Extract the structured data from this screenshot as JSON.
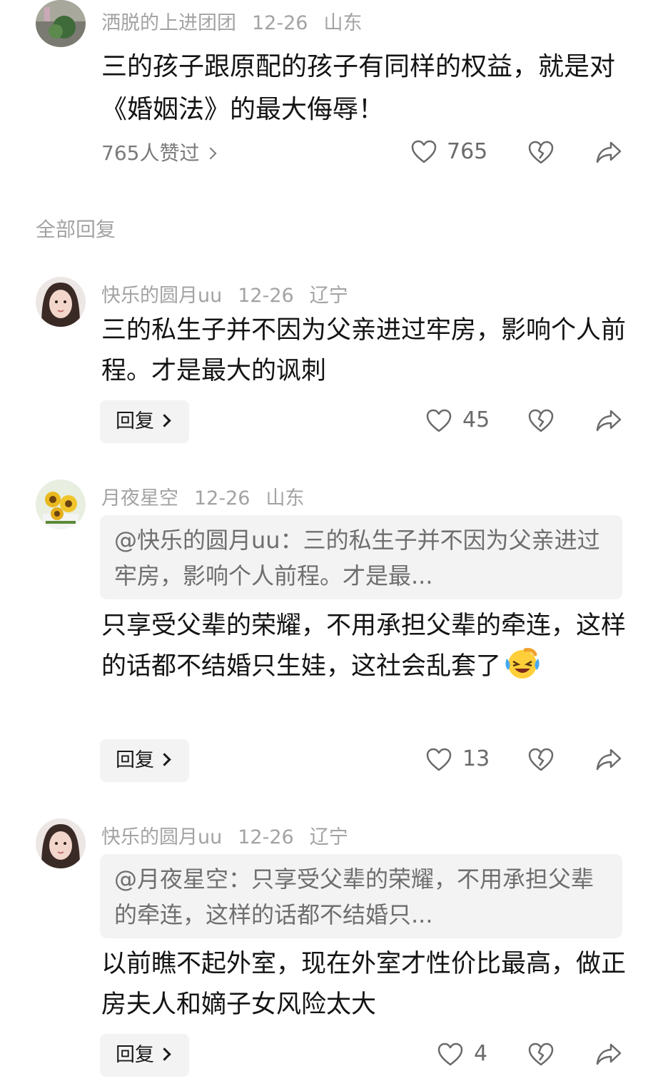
{
  "main_comment": {
    "username": "洒脱的上进团团",
    "date": "12-26",
    "location": "山东",
    "text": "三的孩子跟原配的孩子有同样的权益，就是对《婚姻法》的最大侮辱！",
    "likes_summary": "765人赞过",
    "like_count": "765"
  },
  "section_label": "全部回复",
  "replies": [
    {
      "username": "快乐的圆月uu",
      "date": "12-26",
      "location": "辽宁",
      "text": "三的私生子并不因为父亲进过牢房，影响个人前程。才是最大的讽刺",
      "reply_label": "回复",
      "like_count": "45"
    },
    {
      "username": "月夜星空",
      "date": "12-26",
      "location": "山东",
      "quote": "@快乐的圆月uu：三的私生子并不因为父亲进过牢房，影响个人前程。才是最...",
      "text": "只享受父辈的荣耀，不用承担父辈的牵连，这样的话都不结婚只生娃，这社会乱套了",
      "reply_label": "回复",
      "like_count": "13"
    },
    {
      "username": "快乐的圆月uu",
      "date": "12-26",
      "location": "辽宁",
      "quote": "@月夜星空：只享受父辈的荣耀，不用承担父辈的牵连，这样的话都不结婚只...",
      "text": "以前瞧不起外室，现在外室才性价比最高，做正房夫人和嫡子女风险太大",
      "reply_label": "回复",
      "like_count": "4"
    }
  ],
  "icons": {
    "like": "heart-outline-icon",
    "dislike": "broken-heart-icon",
    "share": "share-arrow-icon",
    "emoji": "laughing-tears-emoji"
  },
  "colors": {
    "meta_text": "#a3a3a3",
    "body_text": "#141414",
    "quote_bg": "#f3f3f3",
    "icon": "#6a6a6a"
  }
}
